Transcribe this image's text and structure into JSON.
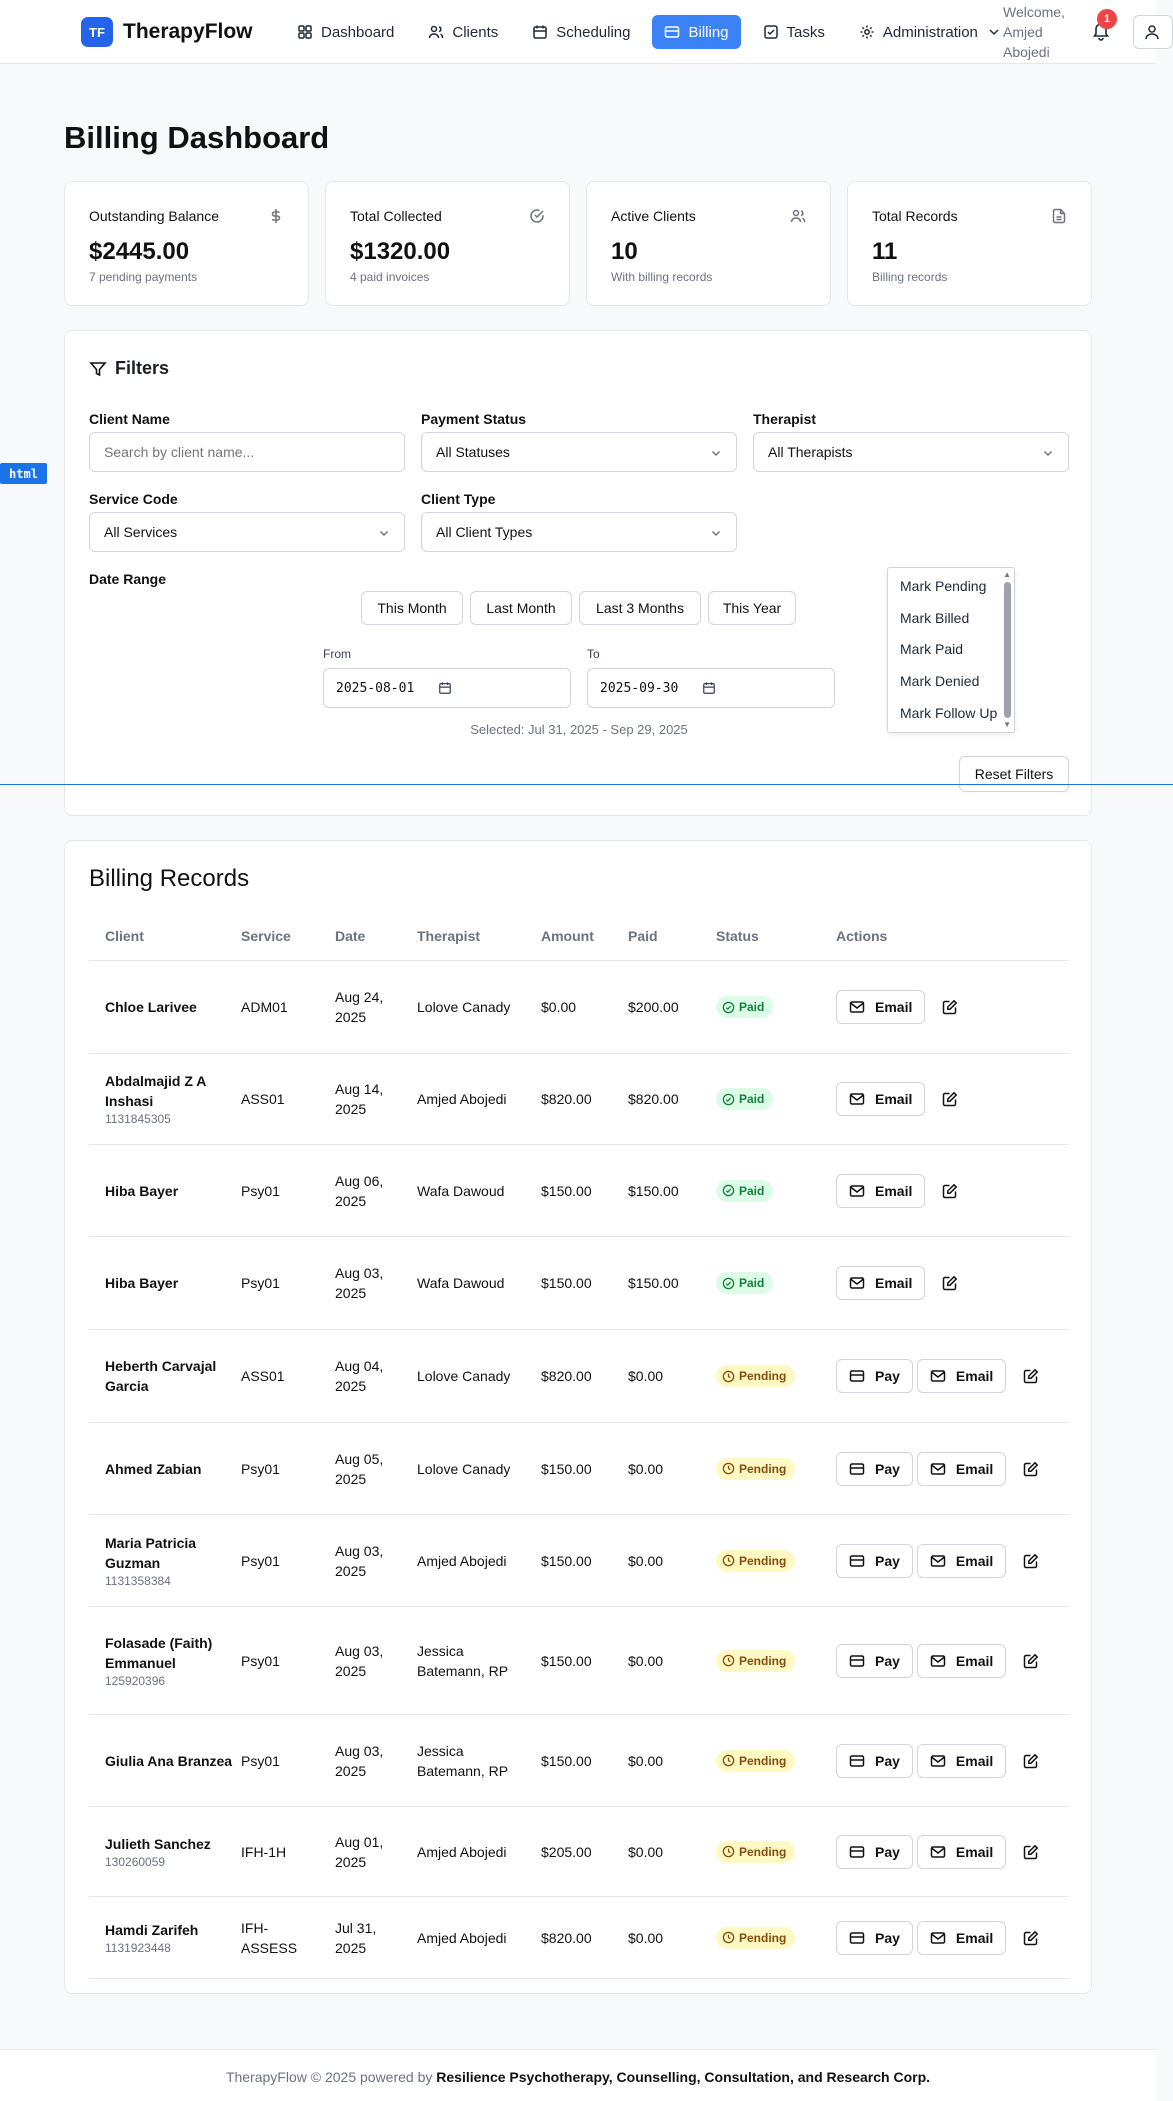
{
  "app": {
    "logo": "TF",
    "name": "TherapyFlow"
  },
  "nav": [
    {
      "label": "Dashboard",
      "icon": "dashboard-icon",
      "active": false
    },
    {
      "label": "Clients",
      "icon": "users-icon",
      "active": false
    },
    {
      "label": "Scheduling",
      "icon": "calendar-icon",
      "active": false
    },
    {
      "label": "Billing",
      "icon": "credit-card-icon",
      "active": true
    },
    {
      "label": "Tasks",
      "icon": "checkbox-icon",
      "active": false
    },
    {
      "label": "Administration",
      "icon": "gear-icon",
      "active": false
    }
  ],
  "header": {
    "welcome": "Welcome,",
    "user_first": "Amjed",
    "user_last": "Abojedi",
    "notification_count": "1"
  },
  "page": {
    "title": "Billing Dashboard"
  },
  "stats": [
    {
      "label": "Outstanding Balance",
      "value": "$2445.00",
      "sub": "7 pending payments",
      "icon": "dollar-icon"
    },
    {
      "label": "Total Collected",
      "value": "$1320.00",
      "sub": "4 paid invoices",
      "icon": "check-circle-icon"
    },
    {
      "label": "Active Clients",
      "value": "10",
      "sub": "With billing records",
      "icon": "users-icon"
    },
    {
      "label": "Total Records",
      "value": "11",
      "sub": "Billing records",
      "icon": "file-icon"
    }
  ],
  "filters": {
    "title": "Filters",
    "client_name_label": "Client Name",
    "client_name_placeholder": "Search by client name...",
    "payment_status_label": "Payment Status",
    "payment_status_value": "All Statuses",
    "therapist_label": "Therapist",
    "therapist_value": "All Therapists",
    "service_code_label": "Service Code",
    "service_code_value": "All Services",
    "client_type_label": "Client Type",
    "client_type_value": "All Client Types",
    "date_range_label": "Date Range",
    "range_buttons": [
      "This Month",
      "Last Month",
      "Last 3 Months",
      "This Year"
    ],
    "from_label": "From",
    "from_value": "2025-08-01",
    "to_label": "To",
    "to_value": "2025-09-30",
    "selected": "Selected: Jul 31, 2025 - Sep 29, 2025",
    "mark_options": [
      "Mark Pending",
      "Mark Billed",
      "Mark Paid",
      "Mark Denied",
      "Mark Follow Up"
    ],
    "reset": "Reset Filters"
  },
  "debug_tag": "html",
  "records": {
    "title": "Billing Records",
    "columns": [
      "Client",
      "Service",
      "Date",
      "Therapist",
      "Amount",
      "Paid",
      "Status",
      "Actions"
    ],
    "pay_label": "Pay",
    "email_label": "Email",
    "rows": [
      {
        "client": "Chloe Larivee",
        "client_id": "",
        "service": "ADM01",
        "date": "Aug 24, 2025",
        "therapist": "Lolove Canady",
        "amount": "$0.00",
        "paid": "$200.00",
        "status": "Paid"
      },
      {
        "client": "Abdalmajid Z A Inshasi",
        "client_id": "1131845305",
        "service": "ASS01",
        "date": "Aug 14, 2025",
        "therapist": "Amjed Abojedi",
        "amount": "$820.00",
        "paid": "$820.00",
        "status": "Paid"
      },
      {
        "client": "Hiba Bayer",
        "client_id": "",
        "service": "Psy01",
        "date": "Aug 06, 2025",
        "therapist": "Wafa Dawoud",
        "amount": "$150.00",
        "paid": "$150.00",
        "status": "Paid"
      },
      {
        "client": "Hiba Bayer",
        "client_id": "",
        "service": "Psy01",
        "date": "Aug 03, 2025",
        "therapist": "Wafa Dawoud",
        "amount": "$150.00",
        "paid": "$150.00",
        "status": "Paid"
      },
      {
        "client": "Heberth Carvajal Garcia",
        "client_id": "",
        "service": "ASS01",
        "date": "Aug 04, 2025",
        "therapist": "Lolove Canady",
        "amount": "$820.00",
        "paid": "$0.00",
        "status": "Pending"
      },
      {
        "client": "Ahmed Zabian",
        "client_id": "",
        "service": "Psy01",
        "date": "Aug 05, 2025",
        "therapist": "Lolove Canady",
        "amount": "$150.00",
        "paid": "$0.00",
        "status": "Pending"
      },
      {
        "client": "Maria Patricia Guzman",
        "client_id": "1131358384",
        "service": "Psy01",
        "date": "Aug 03, 2025",
        "therapist": "Amjed Abojedi",
        "amount": "$150.00",
        "paid": "$0.00",
        "status": "Pending"
      },
      {
        "client": "Folasade (Faith) Emmanuel",
        "client_id": "125920396",
        "service": "Psy01",
        "date": "Aug 03, 2025",
        "therapist": "Jessica Batemann, RP",
        "amount": "$150.00",
        "paid": "$0.00",
        "status": "Pending"
      },
      {
        "client": "Giulia Ana Branzea",
        "client_id": "",
        "service": "Psy01",
        "date": "Aug 03, 2025",
        "therapist": "Jessica Batemann, RP",
        "amount": "$150.00",
        "paid": "$0.00",
        "status": "Pending"
      },
      {
        "client": "Julieth Sanchez",
        "client_id": "130260059",
        "service": "IFH-1H",
        "date": "Aug 01, 2025",
        "therapist": "Amjed Abojedi",
        "amount": "$205.00",
        "paid": "$0.00",
        "status": "Pending"
      },
      {
        "client": "Hamdi Zarifeh",
        "client_id": "1131923448",
        "service": "IFH-ASSESS",
        "date": "Jul 31, 2025",
        "therapist": "Amjed Abojedi",
        "amount": "$820.00",
        "paid": "$0.00",
        "status": "Pending"
      }
    ]
  },
  "footer": {
    "prefix": "TherapyFlow © 2025 powered by",
    "company": "Resilience Psychotherapy, Counselling, Consultation, and Research Corp."
  }
}
